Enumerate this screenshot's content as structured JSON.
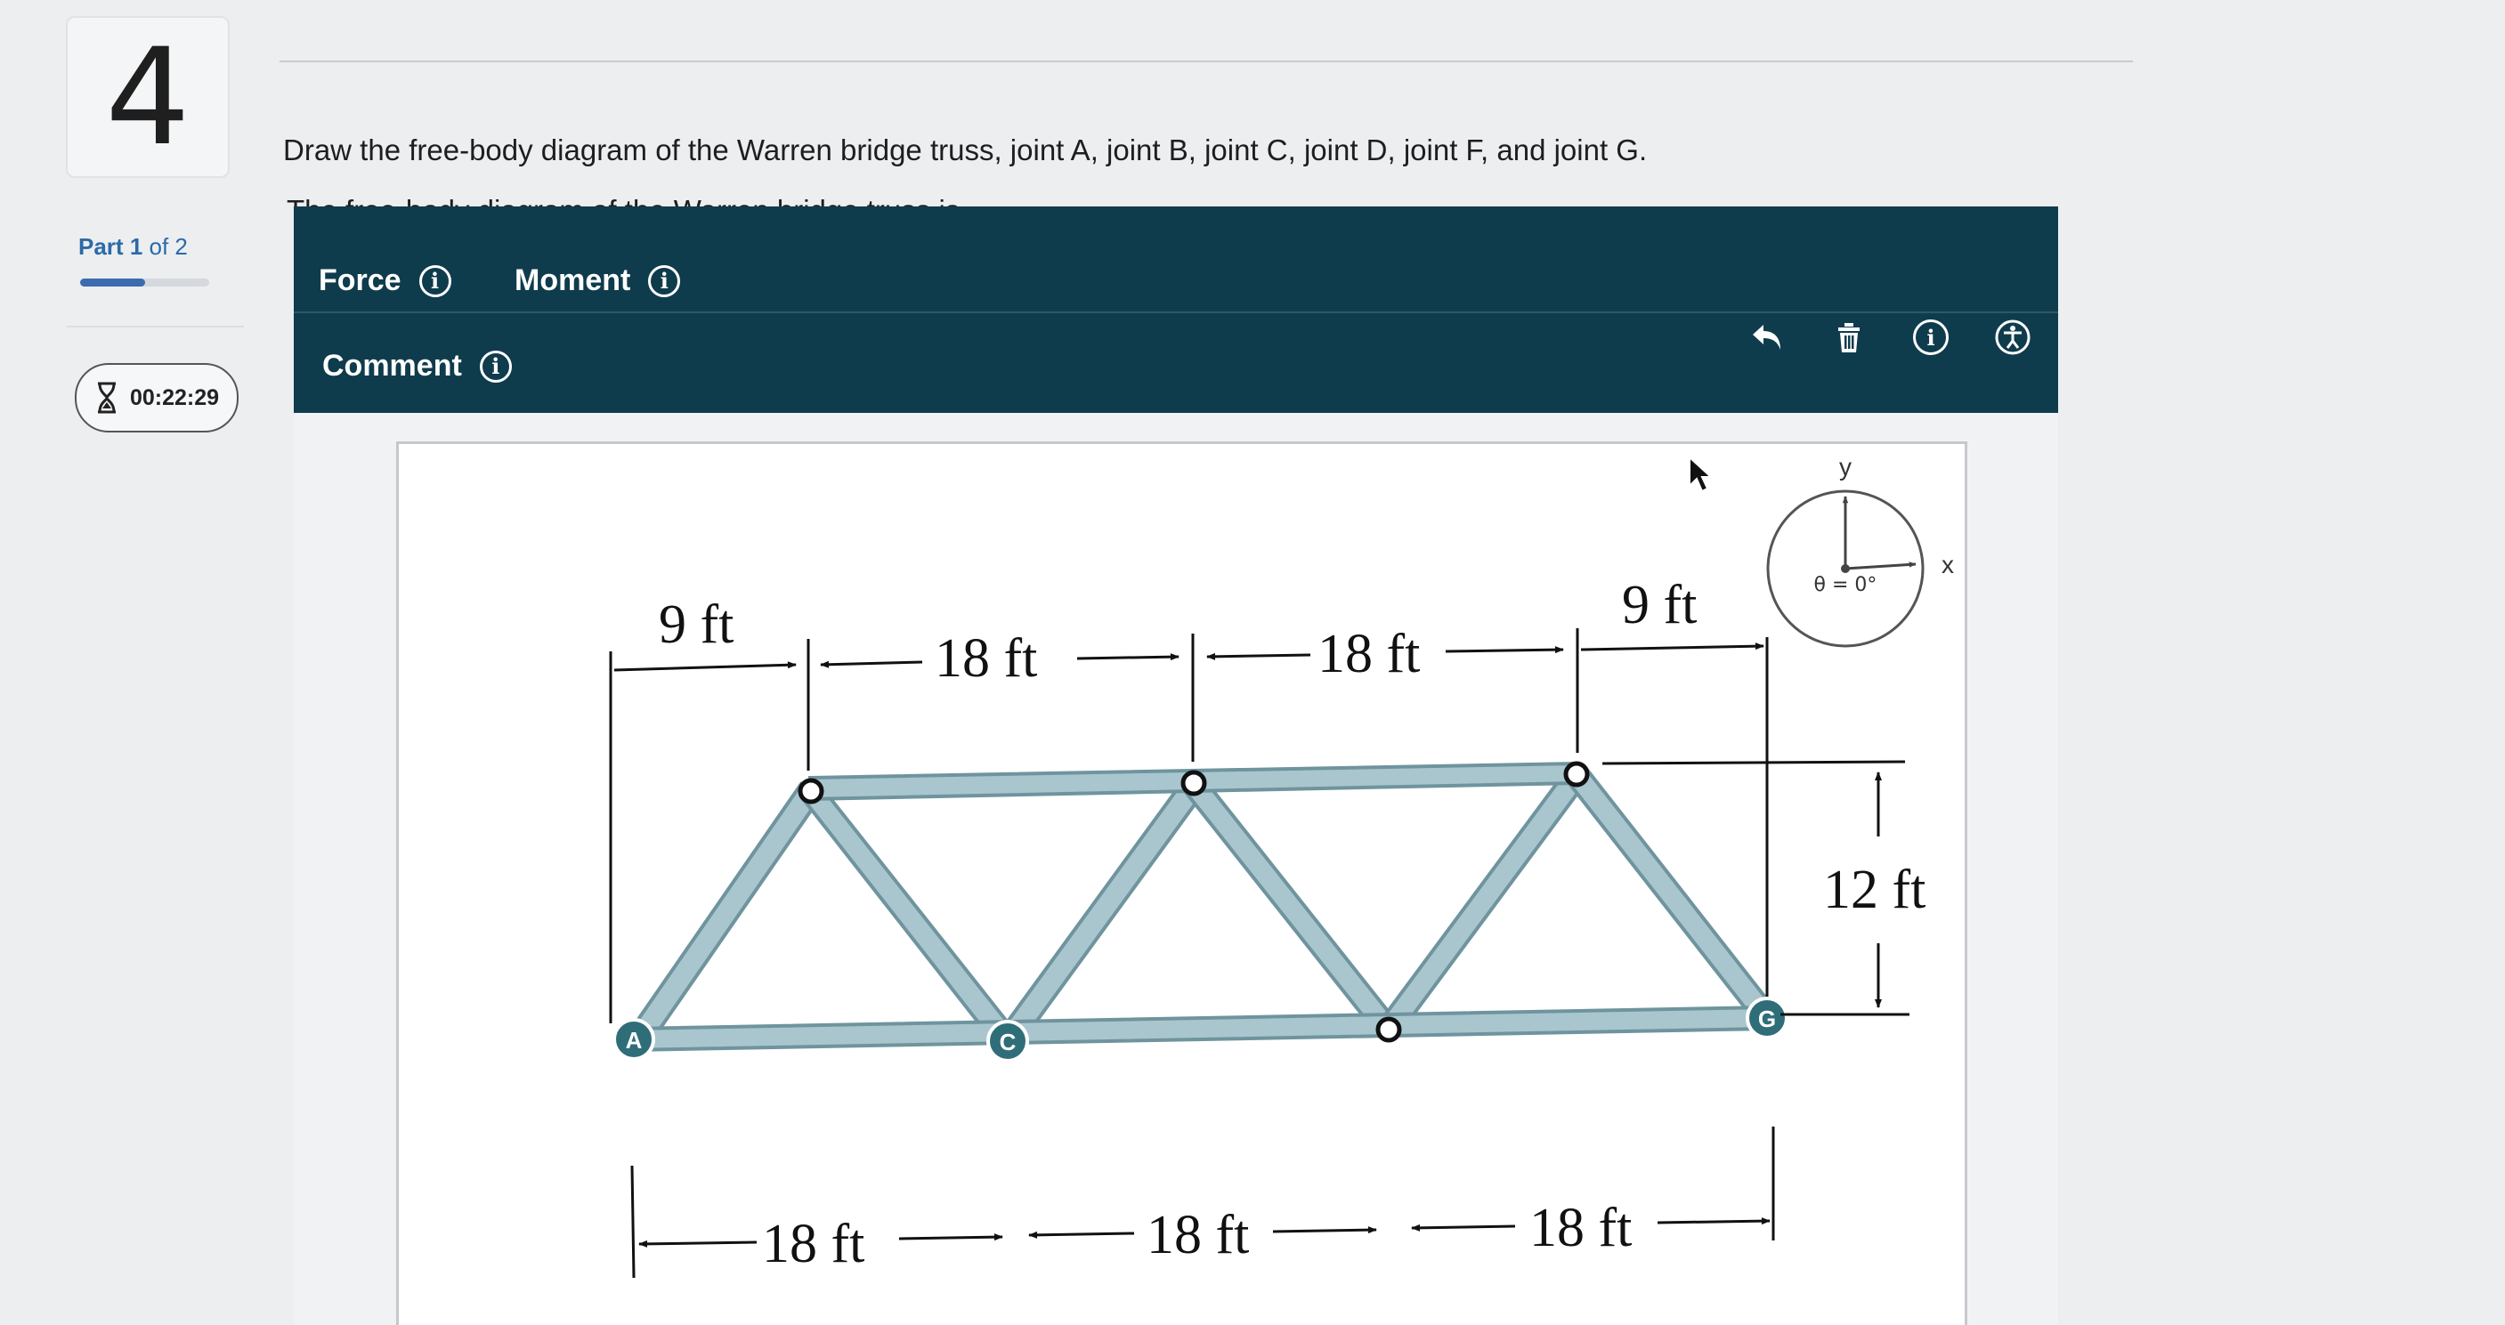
{
  "question": {
    "number": "4"
  },
  "sidebar": {
    "part_prefix": "Part",
    "part_current": "1",
    "part_of": "of 2",
    "progress": 0.5,
    "timer": "00:22:29",
    "timer_icon": "hourglass-icon"
  },
  "prompt": "Draw the free-body diagram of the Warren bridge truss, joint A, joint B, joint C, joint D, joint F, and joint G.",
  "sub_prompt": "The free-body diagram of the Warren bridge truss is",
  "toolbar": {
    "force_label": "Force",
    "moment_label": "Moment",
    "comment_label": "Comment",
    "icons": [
      "undo-icon",
      "trash-icon",
      "info-icon",
      "accessibility-icon"
    ],
    "background": "#0f3c4d"
  },
  "figure": {
    "dims_top": [
      "9 ft",
      "18 ft",
      "18 ft",
      "9 ft"
    ],
    "dims_bottom": [
      "18 ft",
      "18 ft",
      "18 ft"
    ],
    "height_label": "12 ft",
    "joint_labels": [
      "A",
      "C",
      "G"
    ],
    "axis_x": "x",
    "axis_y": "y",
    "angle_label": "θ = 0°",
    "member_color": "#a9c6cf",
    "joint_label_color": "#2f6e78"
  }
}
